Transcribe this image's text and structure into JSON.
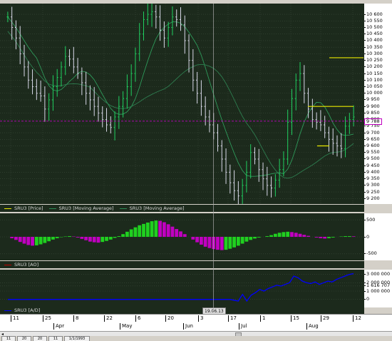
{
  "chart_data": [
    {
      "type": "candlestick",
      "legend_position": "bottom-left",
      "series": [
        {
          "name": "SRU3 [Price]",
          "color": "#e8e800"
        },
        {
          "name": "SRU3 [Moving Average]",
          "color": "#2e8b57"
        },
        {
          "name": "SRU3 [Moving Average]",
          "color": "#2e8b57"
        }
      ],
      "ylim": [
        9180,
        10660
      ],
      "yticks": [
        "10 600",
        "10 550",
        "10 500",
        "10 450",
        "10 400",
        "10 350",
        "10 300",
        "10 250",
        "10 200",
        "10 150",
        "10 100",
        "10 050",
        "10 000",
        "9 950",
        "9 900",
        "9 850",
        "9 800",
        "9 750",
        "9 700",
        "9 650",
        "9 600",
        "9 550",
        "9 500",
        "9 450",
        "9 400",
        "9 350",
        "9 300",
        "9 250",
        "9 200"
      ],
      "current_price": "9 788",
      "grid": true,
      "close": [
        10580,
        10500,
        10420,
        10300,
        10200,
        10100,
        10050,
        10000,
        9980,
        9880,
        9950,
        10050,
        10120,
        10200,
        10280,
        10260,
        10200,
        10150,
        10080,
        10000,
        9950,
        9900,
        9850,
        9800,
        9760,
        9740,
        9820,
        9900,
        9960,
        10050,
        10150,
        10300,
        10450,
        10560,
        10600,
        10620,
        10580,
        10480,
        10420,
        10500,
        10580,
        10560,
        10520,
        10400,
        10250,
        10100,
        10000,
        9900,
        9820,
        9760,
        9700,
        9600,
        9500,
        9400,
        9320,
        9260,
        9220,
        9300,
        9400,
        9550,
        9500,
        9420,
        9350,
        9300,
        9280,
        9340,
        9420,
        9500,
        9780,
        9960,
        10100,
        10150,
        10000,
        9880,
        9800,
        9780,
        9760,
        9700,
        9650,
        9620,
        9600,
        9580,
        9750,
        9800,
        9820
      ]
    },
    {
      "type": "bar",
      "legend_position": "bottom-left",
      "series": [
        {
          "name": "SRU3 [AO]",
          "color": "#c000c0"
        }
      ],
      "ylim": [
        -650,
        650
      ],
      "yticks": [
        "500",
        "0",
        "-500"
      ],
      "values": [
        0,
        -40,
        -90,
        -150,
        -200,
        -240,
        -260,
        -250,
        -220,
        -180,
        -130,
        -80,
        -40,
        -10,
        10,
        20,
        10,
        -20,
        -60,
        -100,
        -140,
        -160,
        -170,
        -150,
        -120,
        -80,
        -30,
        20,
        80,
        150,
        220,
        280,
        340,
        380,
        420,
        460,
        480,
        470,
        430,
        370,
        300,
        230,
        160,
        80,
        0,
        -80,
        -160,
        -230,
        -290,
        -330,
        -360,
        -380,
        -390,
        -380,
        -350,
        -310,
        -260,
        -200,
        -140,
        -90,
        -50,
        -20,
        0,
        20,
        50,
        90,
        120,
        140,
        150,
        140,
        120,
        90,
        60,
        30,
        0,
        -20,
        -40,
        -50,
        -40,
        -20,
        0,
        10,
        20,
        20,
        15
      ]
    },
    {
      "type": "line",
      "legend_position": "bottom-left",
      "series": [
        {
          "name": "SRU3 [A/D]",
          "color": "#0000ff"
        }
      ],
      "ylim": [
        -800000,
        3400000
      ],
      "yticks": [
        "3 000 000",
        "2 000 000",
        "1 616 707",
        "1 000 000",
        "0"
      ],
      "values": [
        0,
        0,
        0,
        0,
        0,
        0,
        0,
        0,
        0,
        0,
        0,
        0,
        0,
        0,
        0,
        0,
        0,
        0,
        0,
        0,
        0,
        0,
        0,
        0,
        0,
        0,
        0,
        0,
        0,
        0,
        0,
        0,
        0,
        0,
        0,
        0,
        0,
        0,
        0,
        0,
        0,
        0,
        0,
        0,
        0,
        0,
        0,
        0,
        0,
        0,
        0,
        0,
        0,
        -100000,
        -200000,
        600000,
        -200000,
        500000,
        800000,
        1200000,
        1000000,
        1300000,
        1500000,
        1700000,
        1600000,
        1800000,
        2000000,
        2800000,
        2600000,
        2200000,
        2000000,
        1900000,
        2100000,
        1800000,
        2000000,
        2200000,
        2100000,
        2400000,
        2600000,
        2800000,
        3000000,
        3100000
      ]
    }
  ],
  "cursor_date": "19.06.13",
  "x_axis": {
    "days": [
      "11",
      "25",
      "8",
      "22",
      "6",
      "20",
      "3",
      "17",
      "1",
      "15",
      "29",
      "12"
    ],
    "months": [
      "Apr",
      "May",
      "Jun",
      "Jul",
      "Aug"
    ]
  },
  "bottom_tabs": [
    "11",
    "20",
    "20",
    "11",
    "1/1/1993"
  ]
}
